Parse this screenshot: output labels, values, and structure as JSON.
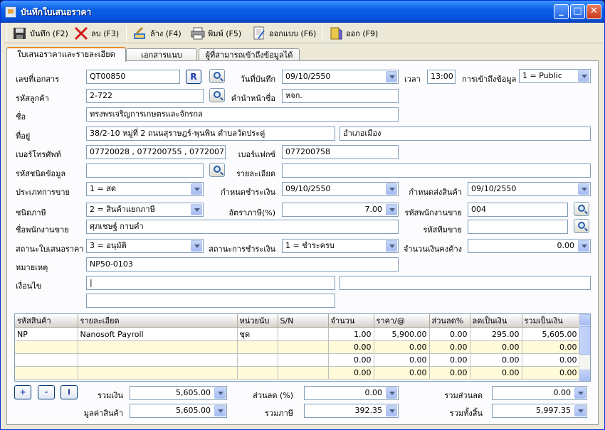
{
  "window": {
    "title": "บันทึกใบเสนอราคา"
  },
  "toolbar": {
    "save": "บันทึก (F2)",
    "delete": "ลบ (F3)",
    "clear": "ล้าง (F4)",
    "print": "พิมพ์ (F5)",
    "design": "ออกแบบ (F6)",
    "exit": "ออก (F9)"
  },
  "tabs": [
    "ใบเสนอราคาและรายละเอียด",
    "เอกสารแนบ",
    "ผู้ที่สามารถเข้าถึงข้อมูลได้"
  ],
  "form": {
    "doc_no_label": "เลขที่เอกสาร",
    "doc_no": "QT00850",
    "r_button": "R",
    "save_date_label": "วันที่บันทึก",
    "save_date": "09/10/2550",
    "time_label": "เวลา",
    "time": "13:00",
    "access_label": "การเข้าถึงข้อมูล",
    "access": "1 = Public",
    "customer_code_label": "รหัสลูกค้า",
    "customer_code": "2-722",
    "prefix_label": "คำนำหน้าชื่อ",
    "prefix": "หจก.",
    "name_label": "ชื่อ",
    "name": "ทรงพรเจริญการเกษตรและจักรกล",
    "address_label": "ที่อยู่",
    "address1": "38/2-10 หมู่ที่ 2 ถนนสุราษฎร์-พุนพิน ตำบลวัดประดู่",
    "address2": "อำเภอเมือง",
    "phone_label": "เบอร์โทรศัพท์",
    "phone": "07720028 , 077200755 , 077200756",
    "fax_label": "เบอร์แฟกซ์",
    "fax": "077200758",
    "data_type_label": "รหัสชนิดข้อมูล",
    "data_type": "",
    "detail_label": "รายละเอียด",
    "detail": "",
    "sale_type_label": "ประเภทการขาย",
    "sale_type": "1 = สด",
    "pay_due_label": "กำหนดชำระเงิน",
    "pay_due": "09/10/2550",
    "delivery_label": "กำหนดส่งสินค้า",
    "delivery": "09/10/2550",
    "tax_type_label": "ชนิดภาษี",
    "tax_type": "2 = สินค้าแยกภาษี",
    "tax_rate_label": "อัตราภาษี(%)",
    "tax_rate": "7.00",
    "salesman_code_label": "รหัสพนักงานขาย",
    "salesman_code": "004",
    "salesman_name_label": "ชื่อพนักงานขาย",
    "salesman_name": "ศุภเชษฐ์ กาบคำ",
    "team_code_label": "รหัสทีมขาย",
    "team_code": "",
    "quote_status_label": "สถานะใบเสนอราคา",
    "quote_status": "3 = อนุมัติ",
    "pay_status_label": "สถานะการชำระเงิน",
    "pay_status": "1 = ชำระครบ",
    "balance_label": "จำนวนเงินคงค้าง",
    "balance": "0.00",
    "remark_label": "หมายเหตุ",
    "remark": "NP50-0103",
    "condition_label": "เงื่อนไข",
    "condition1": "|",
    "condition2": "",
    "condition3": ""
  },
  "grid": {
    "headers": [
      "รหัสสินค้า",
      "รายละเอียด",
      "หน่วยนับ",
      "S/N",
      "จำนวน",
      "ราคา/@",
      "ส่วนลด%",
      "ลดเป็นเงิน",
      "รวมเป็นเงิน"
    ],
    "rows": [
      [
        "NP",
        "Nanosoft Payroll",
        "ชุด",
        "",
        "1.00",
        "5,900.00",
        "0.00",
        "295.00",
        "5,605.00"
      ],
      [
        "",
        "",
        "",
        "",
        "0.00",
        "0.00",
        "0.00",
        "0.00",
        "0.00"
      ],
      [
        "",
        "",
        "",
        "",
        "0.00",
        "0.00",
        "0.00",
        "0.00",
        "0.00"
      ],
      [
        "",
        "",
        "",
        "",
        "0.00",
        "0.00",
        "0.00",
        "0.00",
        "0.00"
      ]
    ]
  },
  "row_buttons": {
    "add": "+",
    "remove": "-",
    "info": "i"
  },
  "totals": {
    "total_label": "รวมเงิน",
    "total": "5,605.00",
    "discount_pct_label": "ส่วนลด (%)",
    "discount_pct": "0.00",
    "total_discount_label": "รวมส่วนลด",
    "total_discount": "0.00",
    "goods_value_label": "มูลค่าสินค้า",
    "goods_value": "5,605.00",
    "total_tax_label": "รวมภาษี",
    "total_tax": "392.35",
    "grand_total_label": "รวมทั้งสิ้น",
    "grand_total": "5,997.35"
  }
}
